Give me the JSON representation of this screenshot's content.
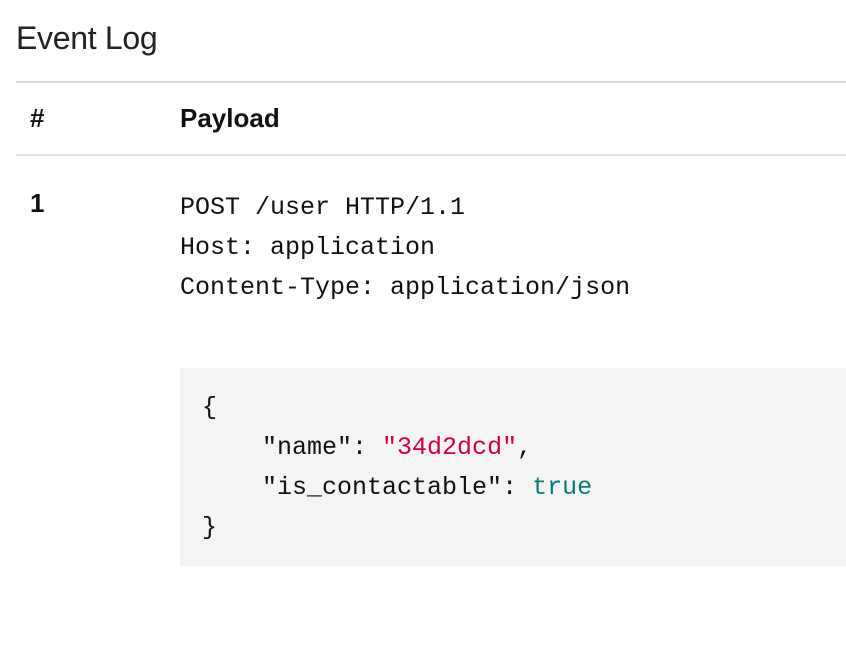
{
  "title": "Event Log",
  "columns": {
    "index": "#",
    "payload": "Payload"
  },
  "rows": [
    {
      "index": "1",
      "headers": "POST /user HTTP/1.1\nHost: application\nContent-Type: application/json",
      "json": {
        "name_key": "\"name\"",
        "name_colon": ": ",
        "name_val": "\"34d2dcd\"",
        "name_end": ",",
        "ic_key": "\"is_contactable\"",
        "ic_colon": ": ",
        "ic_val": "true"
      },
      "indent_open": "{",
      "indent_pad": "    ",
      "indent_close": "}"
    }
  ]
}
